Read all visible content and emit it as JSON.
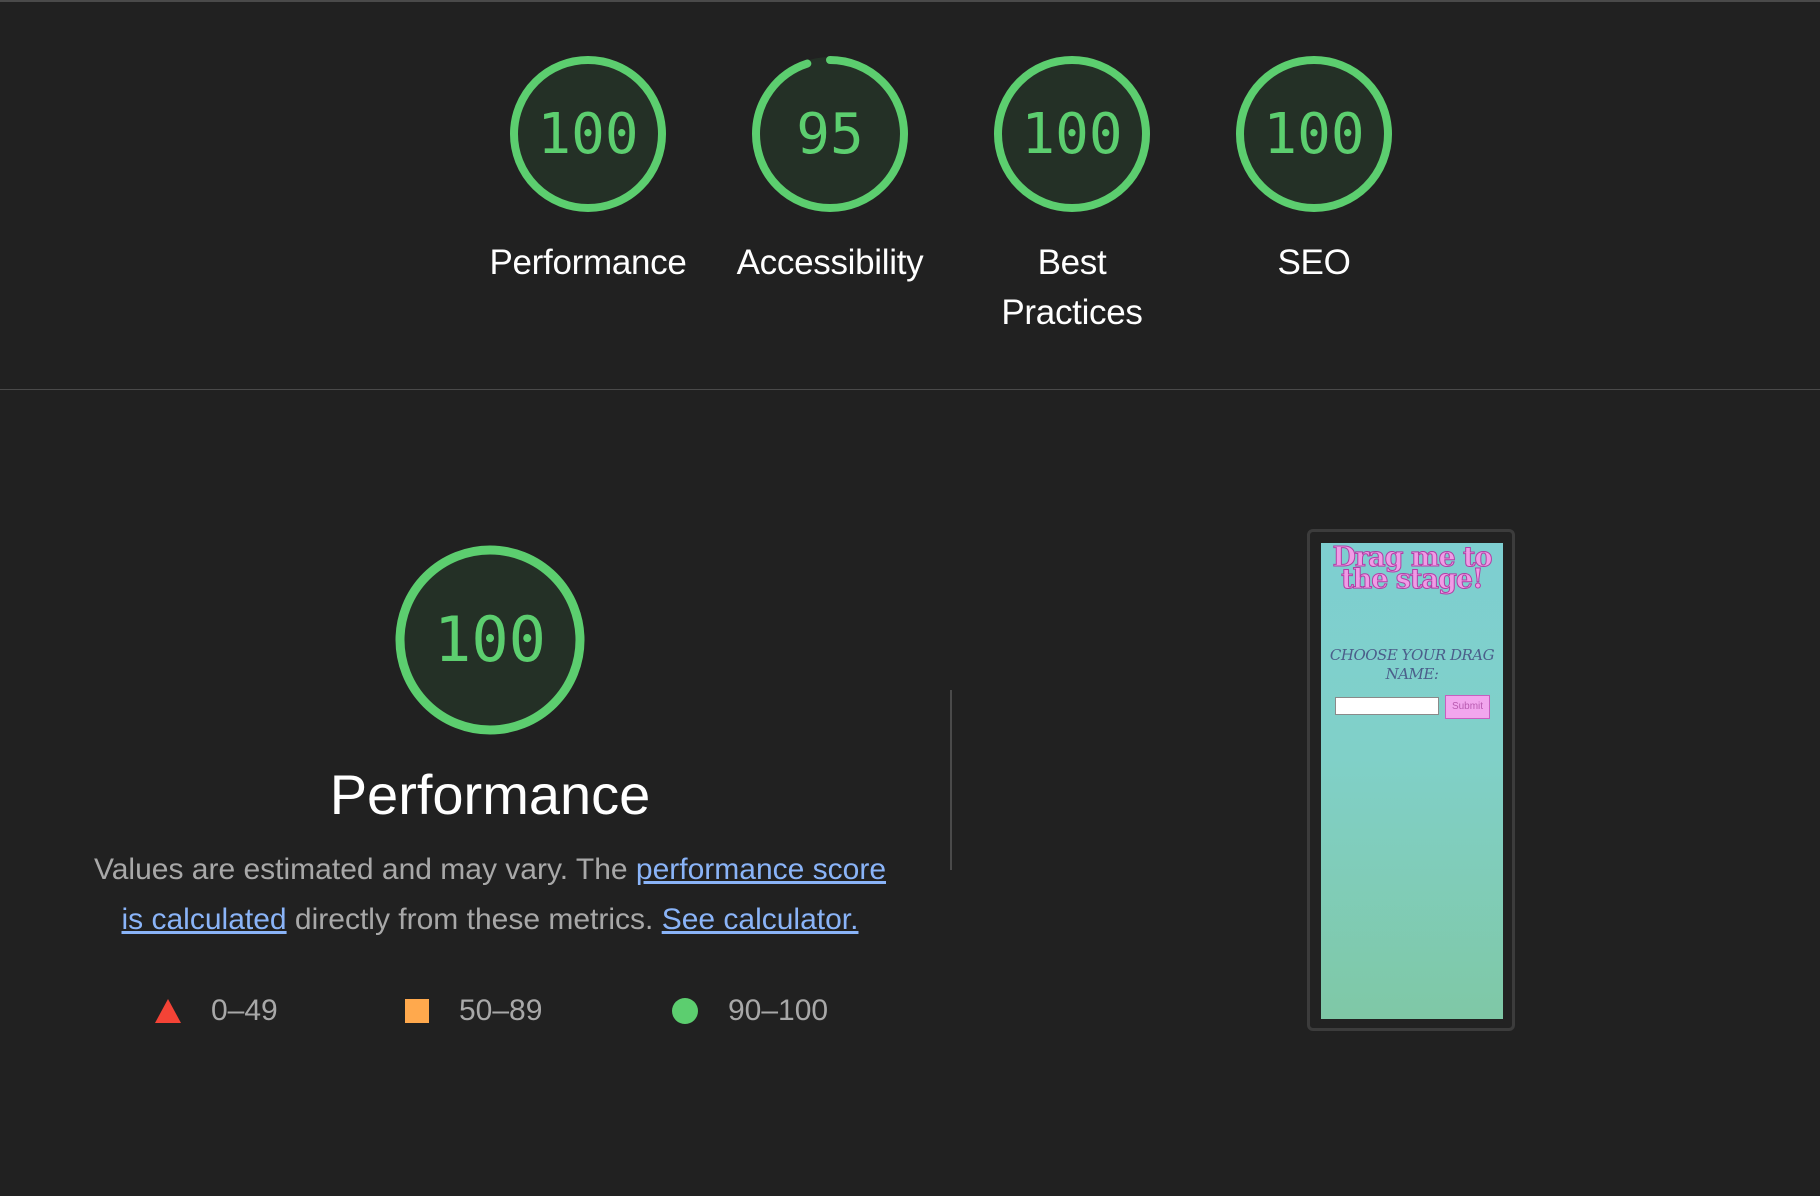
{
  "scores": [
    {
      "id": "performance",
      "value": "100",
      "label": "Performance",
      "fraction": 1.0
    },
    {
      "id": "accessibility",
      "value": "95",
      "label": "Accessibility",
      "fraction": 0.95
    },
    {
      "id": "best-practices",
      "value": "100",
      "label": "Best Practices",
      "fraction": 1.0
    },
    {
      "id": "seo",
      "value": "100",
      "label": "SEO",
      "fraction": 1.0
    }
  ],
  "performance_section": {
    "score": "100",
    "fraction": 1.0,
    "title": "Performance",
    "desc_prefix": "Values are estimated and may vary. The ",
    "link_score": "performance score is calculated",
    "desc_middle": " directly from these metrics. ",
    "link_calculator": "See calculator."
  },
  "legend": [
    {
      "shape": "triangle",
      "range": "0–49",
      "color": "#f44336"
    },
    {
      "shape": "square",
      "range": "50–89",
      "color": "#ffa94d"
    },
    {
      "shape": "circle",
      "range": "90–100",
      "color": "#5cce6f"
    }
  ],
  "screenshot": {
    "title": "Drag me to the stage!",
    "subtitle": "Choose your drag name:",
    "submit_label": "Submit"
  },
  "colors": {
    "pass": "#5cce6f",
    "link": "#8ab4f8",
    "background": "#212121"
  }
}
